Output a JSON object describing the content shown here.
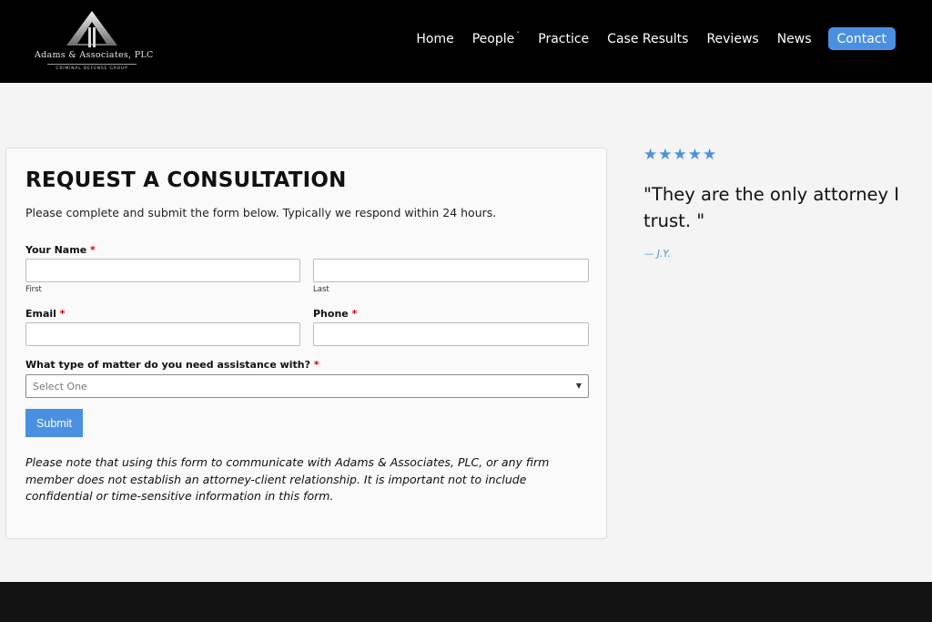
{
  "brand": {
    "name": "Adams & Associates, PLC",
    "tagline": "CRIMINAL DEFENSE GROUP"
  },
  "nav": {
    "items": [
      "Home",
      "People",
      "Practice",
      "Case Results",
      "Reviews",
      "News"
    ],
    "people_caret": "ˇ",
    "contact": "Contact"
  },
  "form": {
    "title": "REQUEST A CONSULTATION",
    "intro": "Please complete and submit the form below. Typically we respond within 24 hours.",
    "name_label": "Your Name",
    "required_mark": "*",
    "first_label": "First",
    "last_label": "Last",
    "email_label": "Email",
    "phone_label": "Phone",
    "matter_label": "What type of matter do you need assistance with?",
    "matter_selected": "Select One",
    "submit_label": "Submit",
    "disclaimer": "Please note that using this form to communicate with Adams & Associates, PLC, or any firm member does not establish an attorney-client relationship. It is important not to include confidential or time-sensitive information in this form."
  },
  "review": {
    "stars_text": "★★★★★",
    "rating": 5,
    "quote": "\"They are the only attorney I trust. \"",
    "author": "— J.Y."
  },
  "colors": {
    "accent": "#4a90e2",
    "header_bg": "#000000",
    "required": "#d0021b"
  }
}
